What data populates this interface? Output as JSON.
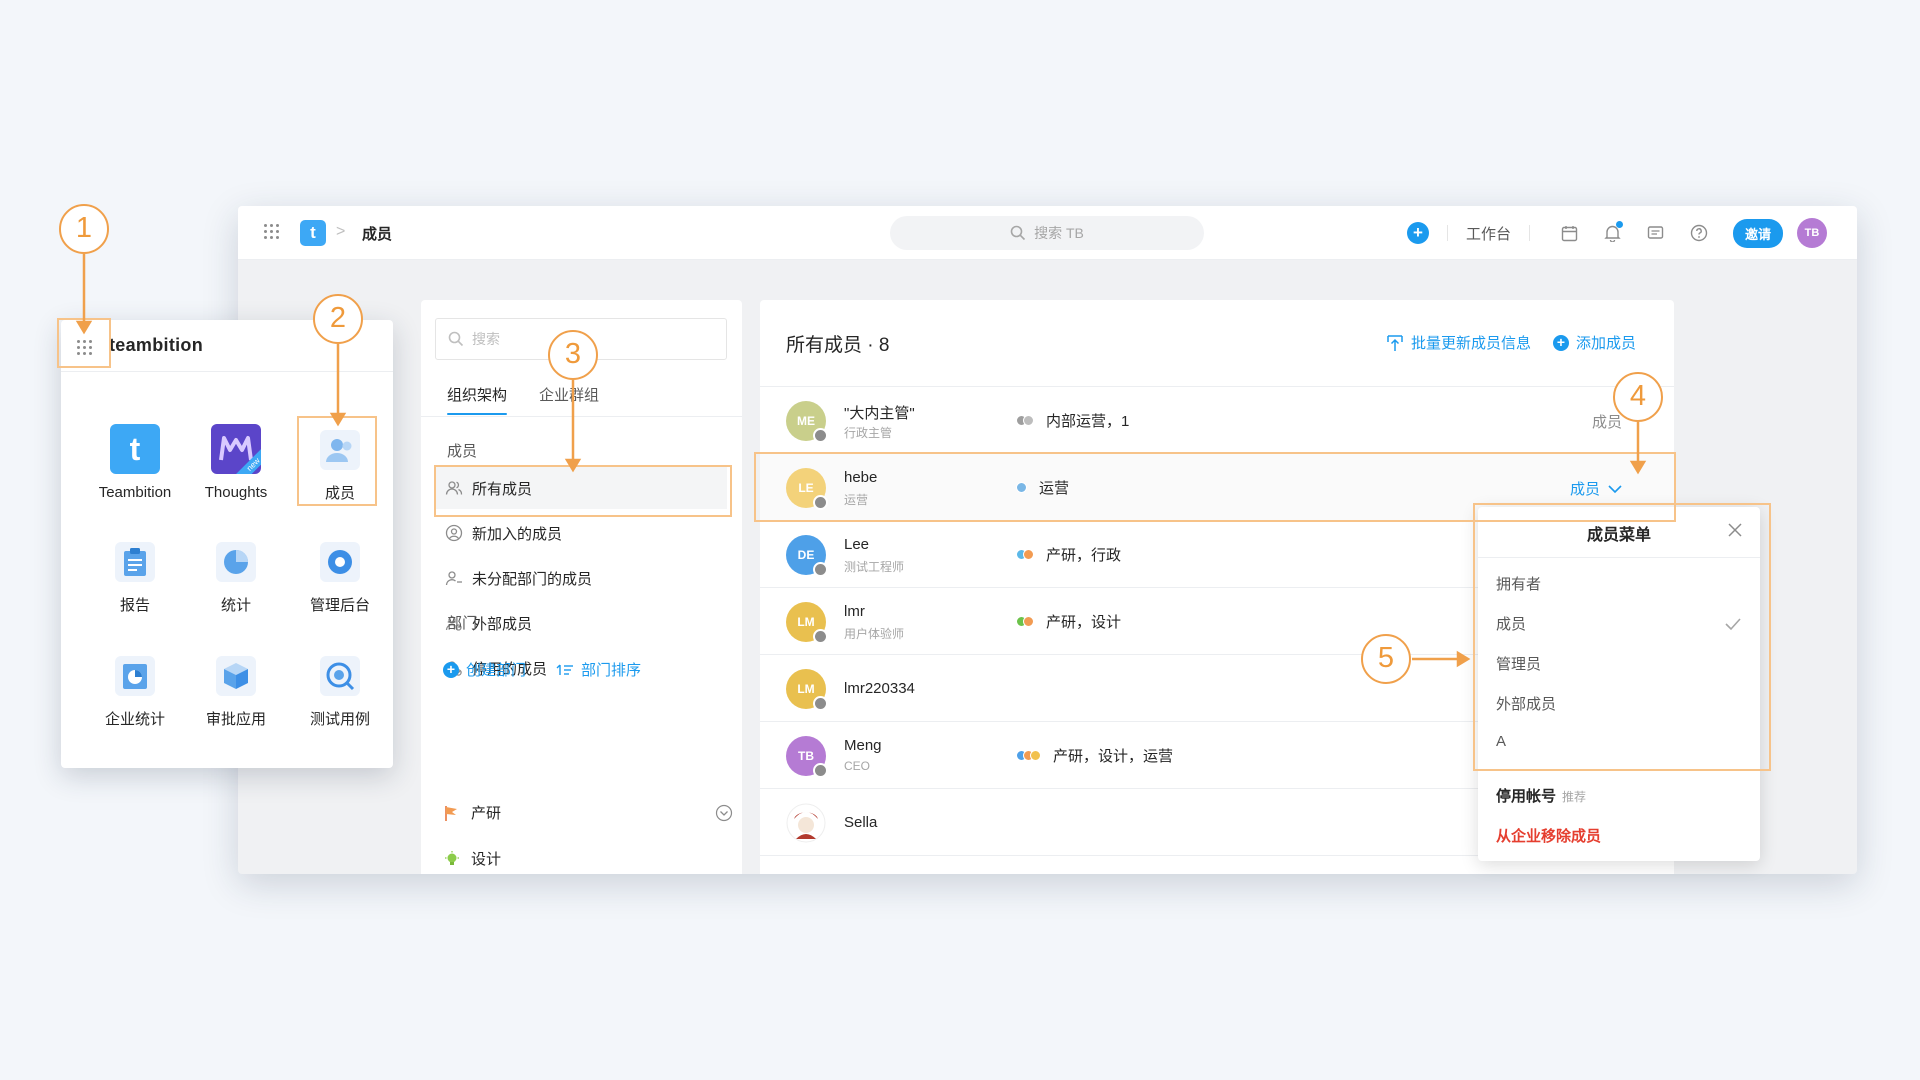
{
  "topbar": {
    "breadcrumb_title": "成员",
    "logo_letter": "t",
    "breadcrumb_sep": ">",
    "search_placeholder": "搜索 TB",
    "add_symbol": "+",
    "workbench": "工作台",
    "invite": "邀请",
    "avatar": "TB"
  },
  "launcher": {
    "brand": "teambition",
    "apps": [
      {
        "label": "Teambition"
      },
      {
        "label": "Thoughts"
      },
      {
        "label": "成员"
      },
      {
        "label": "报告"
      },
      {
        "label": "统计"
      },
      {
        "label": "管理后台"
      },
      {
        "label": "企业统计"
      },
      {
        "label": "审批应用"
      },
      {
        "label": "测试用例"
      }
    ],
    "teambition_letter": "t",
    "thoughts_badge": "new"
  },
  "org_panel": {
    "search_placeholder": "搜索",
    "tabs": [
      "组织架构",
      "企业群组"
    ],
    "members_section": "成员",
    "items": [
      "所有成员",
      "新加入的成员",
      "未分配部门的成员",
      "外部成员",
      "停用的成员"
    ],
    "dept_section": "部门",
    "create_dept": "创建部门",
    "sort_dept": "部门排序",
    "depts": [
      "产研",
      "设计"
    ]
  },
  "member_panel": {
    "title": "所有成员 · 8",
    "batch_update": "批量更新成员信息",
    "add_member": "添加成员",
    "rows": [
      {
        "initials": "ME",
        "name": "\"大内主管\"",
        "sub": "行政主管",
        "dept": "内部运营，1",
        "role": "成员",
        "color": "#c9cf8b",
        "dot_colors": [
          "#9e9e9e",
          "#bdbdbd"
        ]
      },
      {
        "initials": "LE",
        "name": "hebe",
        "sub": "运营",
        "dept": "运营",
        "role": "成员",
        "color": "#f3d27a",
        "dot_colors": [
          "#7ab7e6"
        ]
      },
      {
        "initials": "DE",
        "name": "Lee",
        "sub": "测试工程师",
        "dept": "产研，行政",
        "role": "",
        "color": "#4ea0e8",
        "dot_colors": [
          "#5bb8e8",
          "#f29b52"
        ]
      },
      {
        "initials": "LM",
        "name": "lmr",
        "sub": "用户体验师",
        "dept": "产研，设计",
        "role": "",
        "color": "#e9c04f",
        "dot_colors": [
          "#6cc24a",
          "#f29b52"
        ]
      },
      {
        "initials": "LM",
        "name": "lmr220334",
        "sub": "",
        "dept": "",
        "role": "",
        "color": "#e9c04f",
        "dot_colors": []
      },
      {
        "initials": "TB",
        "name": "Meng",
        "sub": "CEO",
        "dept": "产研，设计，运营",
        "role": "",
        "color": "#b57bd4",
        "dot_colors": [
          "#4ea0e8",
          "#f29b52",
          "#f2c14e"
        ]
      },
      {
        "initials": "",
        "name": "Sella",
        "sub": "",
        "dept": "",
        "role": "",
        "color": "#ffffff",
        "dot_colors": []
      }
    ]
  },
  "member_menu": {
    "title": "成员菜单",
    "options": [
      "拥有者",
      "成员",
      "管理员",
      "外部成员",
      "A"
    ],
    "selected_index": 1,
    "disable_account": "停用帐号",
    "disable_hint": "推荐",
    "remove": "从企业移除成员"
  },
  "callouts": [
    "1",
    "2",
    "3",
    "4",
    "5"
  ],
  "colors": {
    "accent": "#1b9aee",
    "annotation": "#f0a04b",
    "danger": "#e53e2f"
  }
}
